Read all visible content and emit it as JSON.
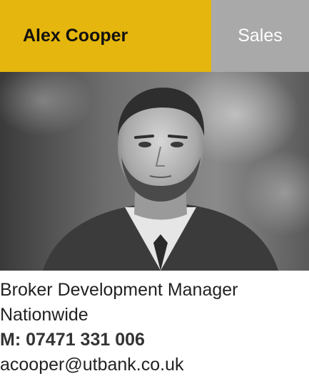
{
  "header": {
    "name": "Alex Cooper",
    "department": "Sales"
  },
  "details": {
    "role": "Broker Development Manager",
    "region": "Nationwide",
    "mobile": "M: 07471 331 006",
    "email": "acooper@utbank.co.uk"
  },
  "colors": {
    "name_bg": "#e5b60d",
    "department_bg": "#a9a9a9"
  },
  "photo": {
    "icon": "portrait-photo-bw"
  }
}
